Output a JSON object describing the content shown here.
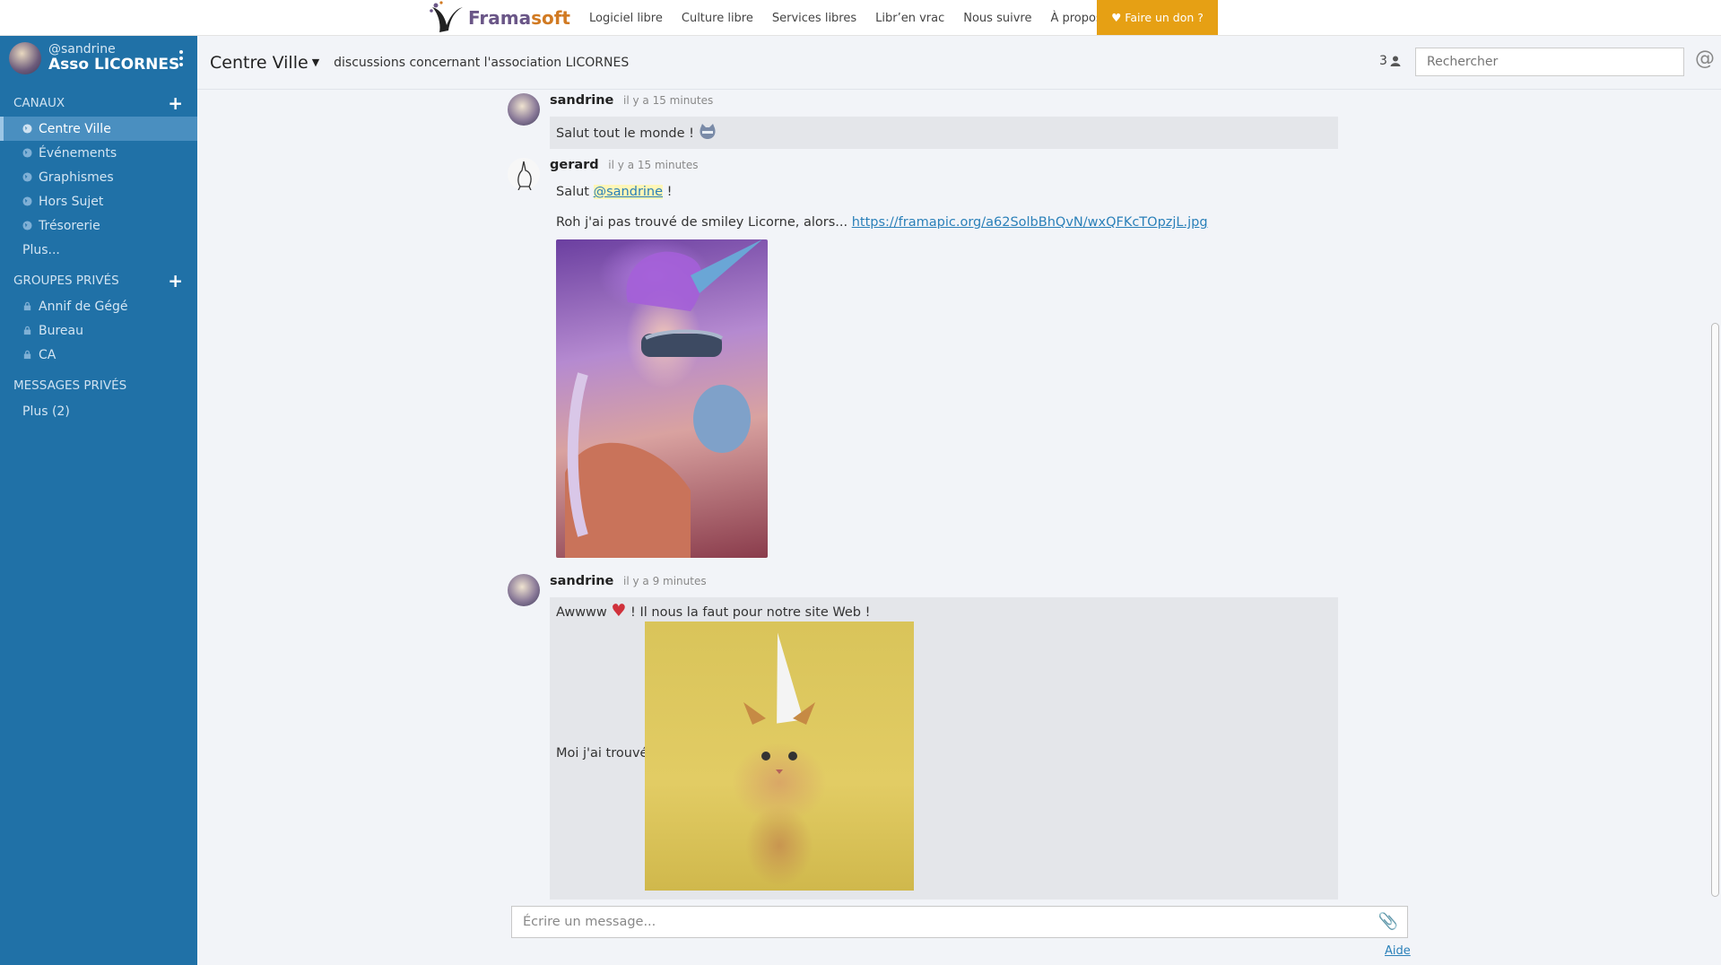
{
  "topnav": {
    "brand_fr": "Frama",
    "brand_soft": "soft",
    "links": [
      "Logiciel libre",
      "Culture libre",
      "Services libres",
      "Libr’en vrac",
      "Nous suivre",
      "À propos"
    ],
    "donate": "Faire un don ?"
  },
  "sidebar": {
    "user": "@sandrine",
    "team": "Asso LICORNES",
    "channels_title": "CANAUX",
    "channels": [
      "Centre Ville",
      "Événements",
      "Graphismes",
      "Hors Sujet",
      "Trésorerie"
    ],
    "channels_more": "Plus...",
    "private_title": "GROUPES PRIVÉS",
    "private_groups": [
      "Annif de Gégé",
      "Bureau",
      "CA"
    ],
    "dm_title": "MESSAGES PRIVÉS",
    "dm_more": "Plus (2)"
  },
  "header": {
    "channel": "Centre Ville",
    "purpose": "discussions concernant l'association LICORNES",
    "member_count": "3",
    "search_placeholder": "Rechercher",
    "at": "@"
  },
  "posts": [
    {
      "author": "sandrine",
      "time": "il y a 15 minutes",
      "text": "Salut tout le monde !"
    },
    {
      "author": "gerard",
      "time": "il y a 15 minutes",
      "line1_pre": "Salut ",
      "mention": "@sandrine",
      "line1_post": " !",
      "line2": "Roh j'ai pas trouvé de smiley Licorne, alors... ",
      "link": "https://framapic.org/a62SolbBhQvN/wxQFKcTOpzjL.jpg"
    },
    {
      "author": "sandrine",
      "time": "il y a 9 minutes",
      "line1_pre": "Awwww ",
      "line1_post": " ! Il nous la faut pour notre site Web !",
      "line2": "Moi j'ai trouvé"
    }
  ],
  "composer": {
    "placeholder": "Écrire un message...",
    "help": "Aide"
  },
  "colors": {
    "sidebar": "#2071a7",
    "donate": "#e6a014",
    "link": "#2a80b9"
  }
}
